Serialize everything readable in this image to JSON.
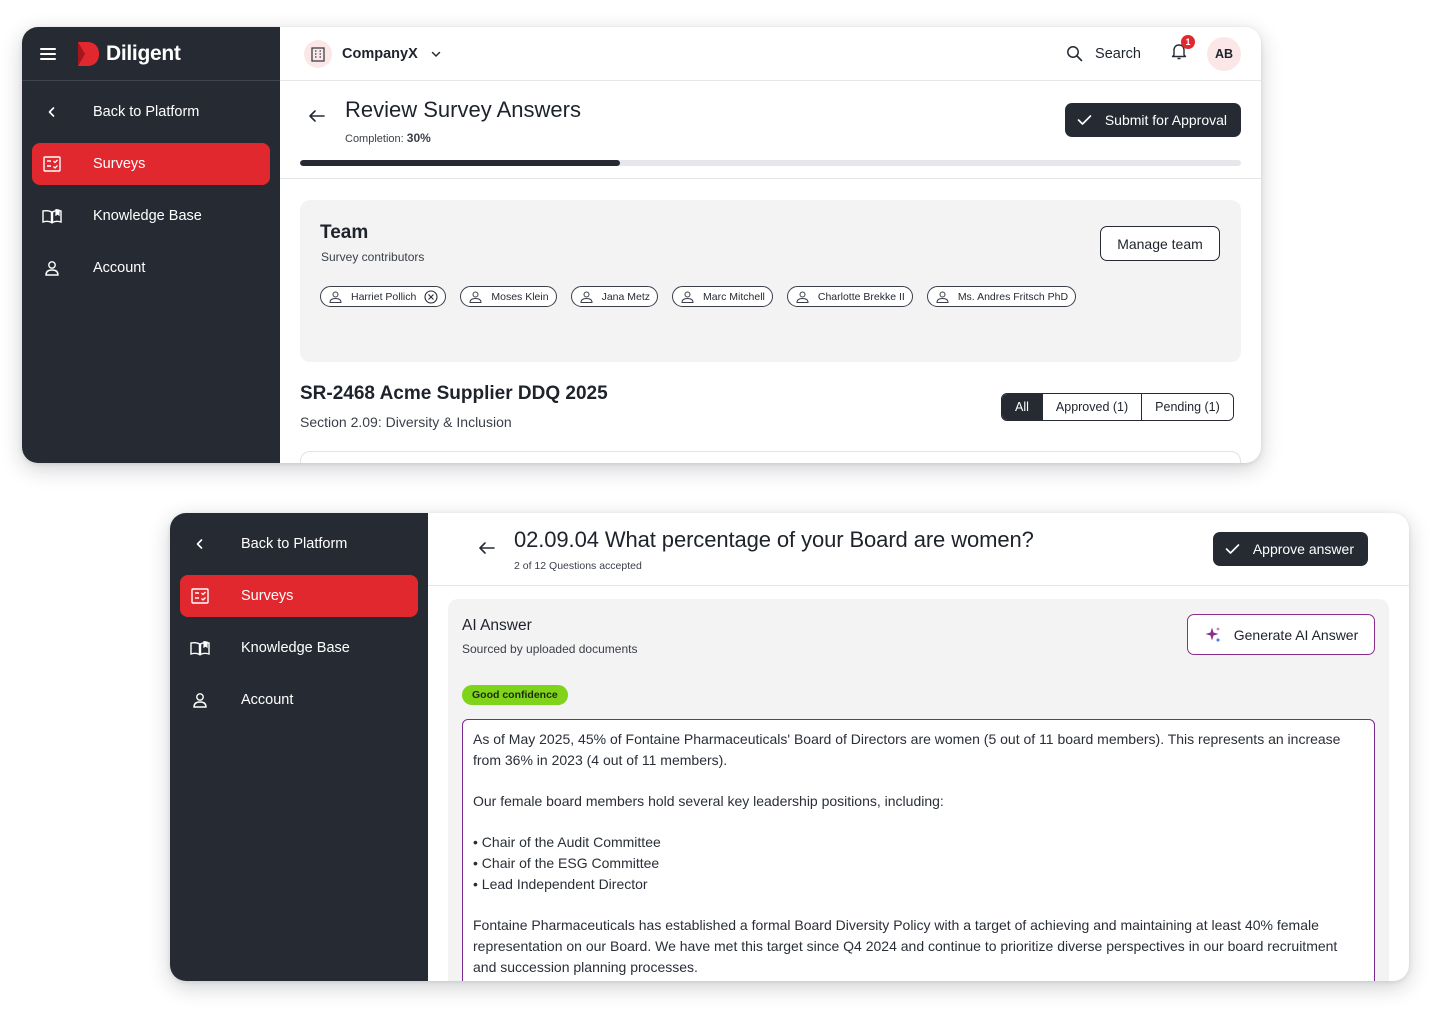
{
  "brand": {
    "name": "Diligent"
  },
  "colors": {
    "brand_red": "#e2282f",
    "sidebar_bg": "#262b33",
    "confidence_green": "#7fd31a",
    "ai_purple": "#7a2a8e"
  },
  "sidebar": {
    "items": [
      {
        "label": "Back to Platform",
        "icon": "chevron-left-icon"
      },
      {
        "label": "Surveys",
        "icon": "survey-checklist-icon",
        "active": true
      },
      {
        "label": "Knowledge Base",
        "icon": "open-book-icon"
      },
      {
        "label": "Account",
        "icon": "person-icon"
      }
    ]
  },
  "topbar": {
    "company": "CompanyX",
    "search_label": "Search",
    "notifications": "1",
    "avatar_initials": "AB"
  },
  "review": {
    "title": "Review Survey Answers",
    "completion_label": "Completion:",
    "completion_value": "30%",
    "progress": 0.3,
    "submit_label": "Submit for Approval"
  },
  "team": {
    "title": "Team",
    "subtitle": "Survey contributors",
    "manage_label": "Manage team",
    "members": [
      "Harriet Pollich",
      "Moses Klein",
      "Jana Metz",
      "Marc Mitchell",
      "Charlotte Brekke II",
      "Ms. Andres Fritsch PhD"
    ]
  },
  "survey": {
    "title": "SR-2468 Acme Supplier DDQ 2025",
    "section": "Section 2.09: Diversity & Inclusion",
    "filters": {
      "all": "All",
      "approved": "Approved (1)",
      "pending": "Pending (1)"
    }
  },
  "question": {
    "title": "02.09.04 What percentage of your Board are women?",
    "accepted": "2 of 12 Questions accepted",
    "approve_label": "Approve answer"
  },
  "ai_answer": {
    "title": "AI Answer",
    "source": "Sourced by  uploaded documents",
    "generate_label": "Generate AI Answer",
    "confidence": "Good confidence",
    "paragraph_1": "As of May 2025, 45% of Fontaine Pharmaceuticals' Board of Directors are women (5 out of 11 board members). This represents an increase from 36% in 2023 (4 out of 11 members).",
    "paragraph_2": "Our female board members hold several key leadership positions, including:",
    "bullets": [
      "• Chair of the Audit Committee",
      "• Chair of the ESG Committee",
      "• Lead Independent Director"
    ],
    "paragraph_3": "Fontaine Pharmaceuticals has established a formal Board Diversity Policy with a target of achieving and maintaining at least 40% female representation on our Board. We have met this target since Q4 2024 and continue to prioritize diverse perspectives in our board recruitment and succession planning processes."
  }
}
